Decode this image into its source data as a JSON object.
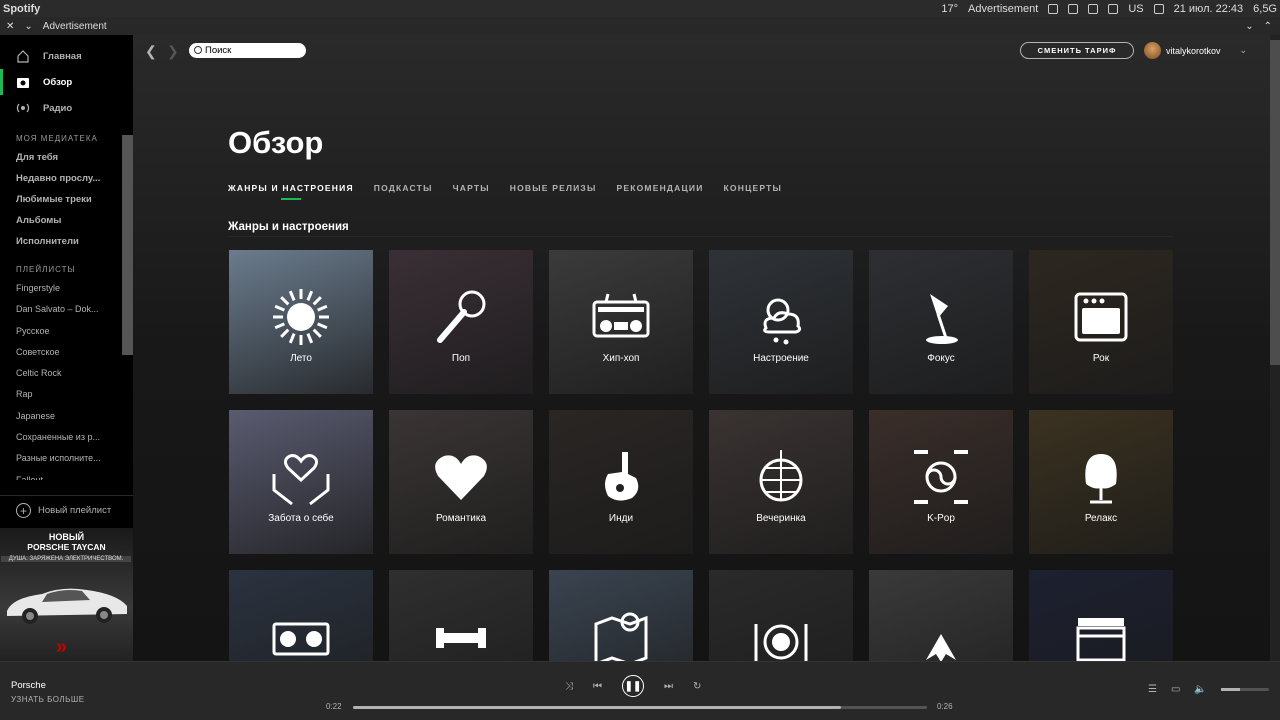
{
  "system": {
    "app_name": "Spotify",
    "weather": "17°",
    "window_title": "Advertisement",
    "keyboard": "US",
    "datetime": "21 июл. 22:43",
    "memory": "6,5G"
  },
  "window": {
    "title": "Advertisement"
  },
  "sidebar": {
    "nav": [
      {
        "label": "Главная",
        "icon": "home-icon"
      },
      {
        "label": "Обзор",
        "icon": "browse-icon",
        "active": true
      },
      {
        "label": "Радио",
        "icon": "radio-icon"
      }
    ],
    "library_header": "МОЯ МЕДИАТЕКА",
    "library": [
      "Для тебя",
      "Недавно прослу...",
      "Любимые треки",
      "Альбомы",
      "Исполнители"
    ],
    "playlists_header": "ПЛЕЙЛИСТЫ",
    "playlists": [
      "Fingerstyle",
      "Dan Salvato – Dok...",
      "Русское",
      "Советское",
      "Celtic Rock",
      "Rap",
      "Japanese",
      "Сохраненные из р...",
      "Разные исполните...",
      "Fallout"
    ],
    "new_playlist": "Новый плейлист"
  },
  "ad": {
    "line1": "НОВЫЙ",
    "line2": "PORSCHE TAYCAN",
    "line3": "ДУША. ЗАРЯЖЕНА ЭЛЕКТРИЧЕСТВОМ."
  },
  "header": {
    "search_placeholder": "Поиск",
    "upgrade_label": "СМЕНИТЬ ТАРИФ",
    "username": "vitalykorotkov"
  },
  "page": {
    "title": "Обзор",
    "tabs": [
      "ЖАНРЫ И НАСТРОЕНИЯ",
      "ПОДКАСТЫ",
      "ЧАРТЫ",
      "НОВЫЕ РЕЛИЗЫ",
      "РЕКОМЕНДАЦИИ",
      "КОНЦЕРТЫ"
    ],
    "section_title": "Жанры и настроения"
  },
  "genres": [
    {
      "label": "Лето",
      "icon": "sun-icon",
      "bg": "#6b7c8e"
    },
    {
      "label": "Поп",
      "icon": "microphone-icon",
      "bg": "#3a2f36"
    },
    {
      "label": "Хип-хоп",
      "icon": "boombox-icon",
      "bg": "#3b3b3b"
    },
    {
      "label": "Настроение",
      "icon": "weather-icon",
      "bg": "#2f3338"
    },
    {
      "label": "Фокус",
      "icon": "lamp-icon",
      "bg": "#2d2f33"
    },
    {
      "label": "Рок",
      "icon": "amplifier-icon",
      "bg": "#2d2720"
    },
    {
      "label": "Забота о себе",
      "icon": "care-hands-icon",
      "bg": "#5a5b70"
    },
    {
      "label": "Романтика",
      "icon": "heart-icon",
      "bg": "#3a3534"
    },
    {
      "label": "Инди",
      "icon": "guitar-icon",
      "bg": "#2a2624"
    },
    {
      "label": "Вечеринка",
      "icon": "disco-ball-icon",
      "bg": "#3a3332"
    },
    {
      "label": "K-Pop",
      "icon": "taegeuk-icon",
      "bg": "#3a2e2a"
    },
    {
      "label": "Релакс",
      "icon": "egg-chair-icon",
      "bg": "#3b3220"
    },
    {
      "label": "",
      "icon": "turntables-icon",
      "bg": "#2b3340"
    },
    {
      "label": "",
      "icon": "dumbbell-icon",
      "bg": "#2f2f2f"
    },
    {
      "label": "",
      "icon": "map-pin-icon",
      "bg": "#3a4450"
    },
    {
      "label": "",
      "icon": "dinner-plate-icon",
      "bg": "#2a2a2a"
    },
    {
      "label": "",
      "icon": "metal-guitar-icon",
      "bg": "#3a3a3a"
    },
    {
      "label": "",
      "icon": "clapperboard-icon",
      "bg": "#1c2030"
    }
  ],
  "player": {
    "track": "Porsche",
    "learn_more": "УЗНАТЬ БОЛЬШЕ",
    "current": "0:22",
    "duration": "0:26",
    "progress": 0.85,
    "volume": 0.4
  },
  "colors": {
    "accent": "#1db954",
    "background": "#121212",
    "sidebar": "#000000"
  }
}
